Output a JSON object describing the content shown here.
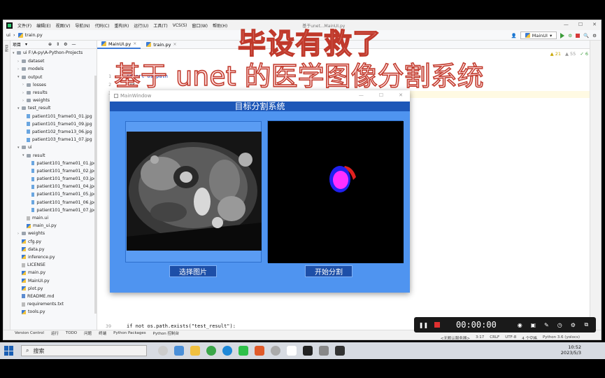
{
  "ide": {
    "menu": [
      "文件(F)",
      "编辑(E)",
      "视图(V)",
      "导航(N)",
      "代码(C)",
      "重构(R)",
      "运行(U)",
      "工具(T)",
      "VCS(S)",
      "窗口(W)",
      "帮助(H)"
    ],
    "window_title": "基于unet...MainUI.py",
    "project_root": "ui",
    "open_file": "train.py",
    "run_config": "MainUI",
    "project_label": "项目",
    "project_path": "ui F:\\A-py\\A-Python-Projects",
    "tree": [
      {
        "type": "folder",
        "name": "dataset",
        "indent": 1
      },
      {
        "type": "folder",
        "name": "models",
        "indent": 1
      },
      {
        "type": "folder-open",
        "name": "output",
        "indent": 1
      },
      {
        "type": "folder",
        "name": "losses",
        "indent": 2
      },
      {
        "type": "folder",
        "name": "results",
        "indent": 2
      },
      {
        "type": "folder",
        "name": "weights",
        "indent": 2
      },
      {
        "type": "folder-open",
        "name": "test_result",
        "indent": 1
      },
      {
        "type": "jpg",
        "name": "patient101_frame01_01.jpg",
        "indent": 2
      },
      {
        "type": "jpg",
        "name": "patient101_frame01_09.jpg",
        "indent": 2
      },
      {
        "type": "jpg",
        "name": "patient102_frame13_06.jpg",
        "indent": 2
      },
      {
        "type": "jpg",
        "name": "patient103_frame11_07.jpg",
        "indent": 2
      },
      {
        "type": "folder-open",
        "name": "ui",
        "indent": 1
      },
      {
        "type": "folder-open",
        "name": "result",
        "indent": 2
      },
      {
        "type": "jpg",
        "name": "patient101_frame01_01.jpg",
        "indent": 3
      },
      {
        "type": "jpg",
        "name": "patient101_frame01_02.jpg",
        "indent": 3
      },
      {
        "type": "jpg",
        "name": "patient101_frame01_03.jpg",
        "indent": 3
      },
      {
        "type": "jpg",
        "name": "patient101_frame01_04.jpg",
        "indent": 3
      },
      {
        "type": "jpg",
        "name": "patient101_frame01_05.jpg",
        "indent": 3
      },
      {
        "type": "jpg",
        "name": "patient101_frame01_06.jpg",
        "indent": 3
      },
      {
        "type": "jpg",
        "name": "patient101_frame01_07.jpg",
        "indent": 3
      },
      {
        "type": "txt",
        "name": "main.ui",
        "indent": 2
      },
      {
        "type": "py",
        "name": "main_ui.py",
        "indent": 2
      },
      {
        "type": "folder",
        "name": "weights",
        "indent": 1
      },
      {
        "type": "py",
        "name": "cfg.py",
        "indent": 1
      },
      {
        "type": "py",
        "name": "data.py",
        "indent": 1
      },
      {
        "type": "py",
        "name": "inference.py",
        "indent": 1
      },
      {
        "type": "txt",
        "name": "LICENSE",
        "indent": 1
      },
      {
        "type": "py",
        "name": "main.py",
        "indent": 1
      },
      {
        "type": "py",
        "name": "MainUI.py",
        "indent": 1
      },
      {
        "type": "py",
        "name": "plot.py",
        "indent": 1
      },
      {
        "type": "md",
        "name": "README.md",
        "indent": 1
      },
      {
        "type": "txt",
        "name": "requirements.txt",
        "indent": 1
      },
      {
        "type": "py",
        "name": "tools.py",
        "indent": 1
      }
    ],
    "editor_tabs": [
      "MainUI.py",
      "train.py"
    ],
    "code": {
      "line1": "import os.path",
      "line2": "sys",
      "line3": "rt-string",
      "line39": "if not os.path.exists(\"test_result\"):"
    },
    "line_numbers": [
      "1",
      "2",
      "3",
      "",
      "",
      "",
      "",
      "",
      "",
      "",
      "",
      "",
      "",
      "",
      "",
      "",
      "",
      "",
      "",
      "",
      "",
      "",
      "",
      "",
      "",
      "",
      "",
      "",
      "",
      "",
      "",
      "",
      "",
      "",
      "",
      "",
      "",
      "",
      "39"
    ],
    "inspections": {
      "warnings": "21",
      "weak": "55",
      "ok": "6"
    },
    "bottom_tools": [
      "Version Control",
      "运行",
      "TODO",
      "问题",
      "终端",
      "Python Packages",
      "Python 控制台"
    ],
    "status": [
      "<无默认服务器>",
      "3:17",
      "CRLF",
      "UTF-8",
      "4 个空格",
      "Python 3.6 (yolocs)"
    ]
  },
  "mainwindow": {
    "title": "MainWindow",
    "header": "目标分割系统",
    "select_button": "选择图片",
    "segment_button": "开始分割"
  },
  "captions": {
    "line1": "毕设有救了",
    "line2": "基于 unet 的医学图像分割系统"
  },
  "recorder": {
    "time": "00:00:00"
  },
  "taskbar": {
    "search_placeholder": "搜索",
    "time": "10:52",
    "date": "2023/5/3"
  }
}
